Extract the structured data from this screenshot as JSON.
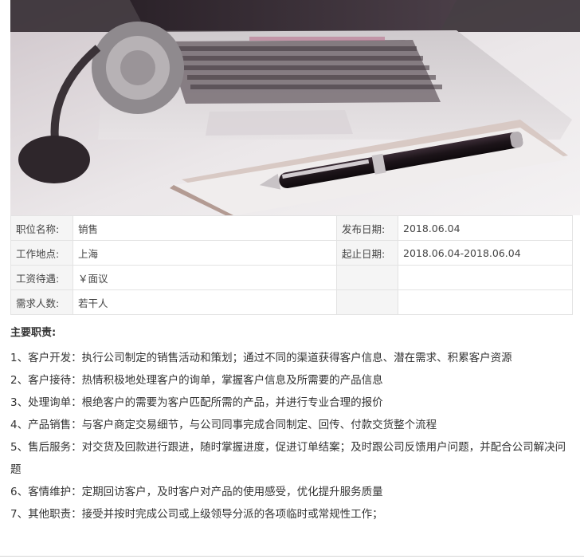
{
  "job": {
    "title_label": "职位名称:",
    "title_value": "销售",
    "publish_label": "发布日期:",
    "publish_value": "2018.06.04",
    "location_label": "工作地点:",
    "location_value": "上海",
    "period_label": "起止日期:",
    "period_value": "2018.06.04-2018.06.04",
    "salary_label": "工资待遇:",
    "salary_value": "￥面议",
    "headcount_label": "需求人数:",
    "headcount_value": "若干人"
  },
  "duties": {
    "title": "主要职责:",
    "items": [
      "1、客户开发：执行公司制定的销售活动和策划；通过不同的渠道获得客户信息、潜在需求、积累客户资源",
      "2、客户接待：热情积极地处理客户的询单，掌握客户信息及所需要的产品信息",
      "3、处理询单：根绝客户的需要为客户匹配所需的产品，并进行专业合理的报价",
      "4、产品销售：与客户商定交易细节，与公司同事完成合同制定、回传、付款交货整个流程",
      "5、售后服务：对交货及回款进行跟进，随时掌握进度，促进订单结案；及时跟公司反馈用户问题，并配合公司解决问题",
      "6、客情维护：定期回访客户，及时客户对产品的使用感受，优化提升服务质量",
      "7、其他职责：接受并按时完成公司或上级领导分派的各项临时或常规性工作；"
    ]
  }
}
